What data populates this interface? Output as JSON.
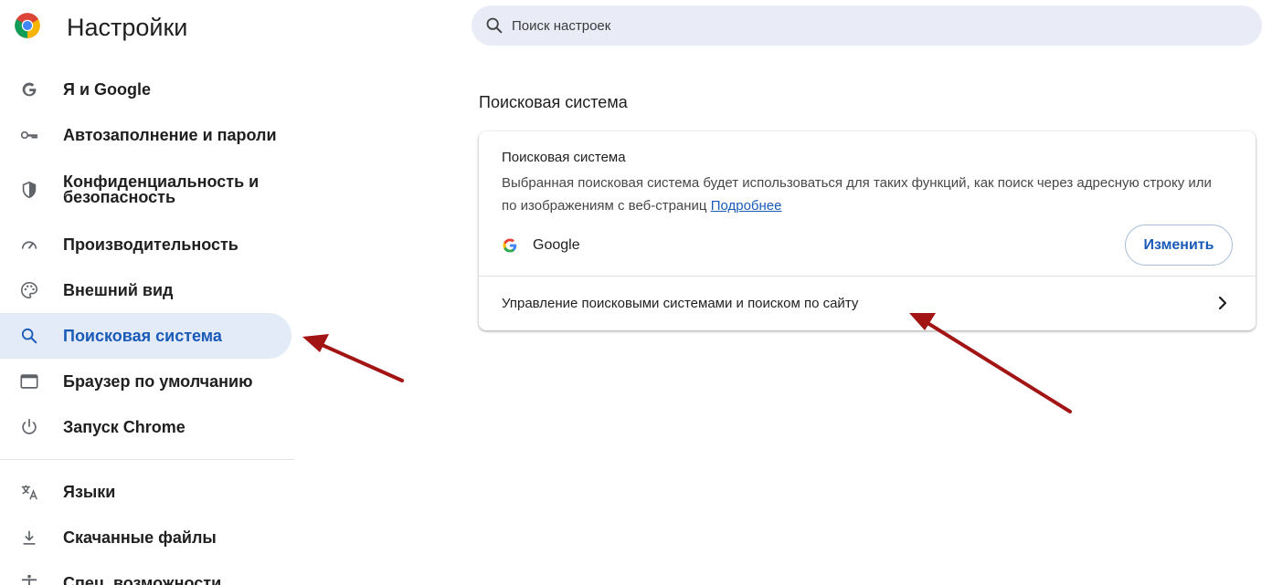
{
  "header": {
    "title": "Настройки",
    "search_placeholder": "Поиск настроек"
  },
  "sidebar": {
    "items": [
      {
        "label": "Я и Google",
        "icon": "google-g-icon"
      },
      {
        "label": "Автозаполнение и пароли",
        "icon": "key-icon"
      },
      {
        "label": "Конфиденциальность и безопасность",
        "icon": "shield-icon"
      },
      {
        "label": "Производительность",
        "icon": "speedometer-icon"
      },
      {
        "label": "Внешний вид",
        "icon": "palette-icon"
      },
      {
        "label": "Поисковая система",
        "icon": "search-icon",
        "active": true
      },
      {
        "label": "Браузер по умолчанию",
        "icon": "browser-window-icon"
      },
      {
        "label": "Запуск Chrome",
        "icon": "power-icon"
      },
      {
        "label": "Языки",
        "icon": "translate-icon"
      },
      {
        "label": "Скачанные файлы",
        "icon": "download-icon"
      },
      {
        "label": "Спец. возможности",
        "icon": "accessibility-icon"
      }
    ]
  },
  "main": {
    "section_title": "Поисковая система",
    "card": {
      "heading": "Поисковая система",
      "description": "Выбранная поисковая система будет использоваться для таких функций, как поиск через адресную строку или по изображениям с веб-страниц",
      "learn_more": "Подробнее",
      "engine_name": "Google",
      "change_button": "Изменить",
      "manage_label": "Управление поисковыми системами и поиском по сайту"
    }
  },
  "colors": {
    "accent": "#1a5bb8",
    "active_bg": "#e3eaf8",
    "search_bg": "#e9ebf6",
    "arrow": "#a31515"
  }
}
